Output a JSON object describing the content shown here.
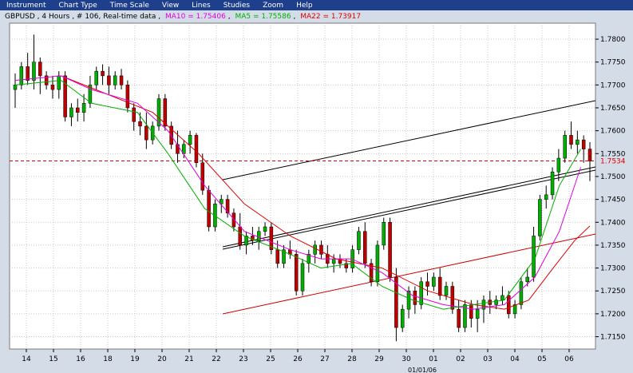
{
  "menu": [
    "Instrument",
    "Chart Type",
    "Time Scale",
    "View",
    "Lines",
    "Studies",
    "Zoom",
    "Help"
  ],
  "header": {
    "symbol": "GBPUSD , 4 Hours , # 106, Real-time data",
    "ma10": "MA10 = 1.75406",
    "ma5": "MA5 = 1.75586",
    "ma22": "MA22 = 1.73917",
    "sep": ","
  },
  "colors": {
    "ma10": "#e000e0",
    "ma5": "#00b000",
    "ma22": "#e00000",
    "bull": "#00b000",
    "bear": "#c00000",
    "menubar": "#1d3f8c"
  },
  "chart_data": {
    "type": "candlestick",
    "y_ticks": [
      "1.7800",
      "1.7750",
      "1.7700",
      "1.7650",
      "1.7600",
      "1.7550",
      "1.7500",
      "1.7450",
      "1.7400",
      "1.7350",
      "1.7300",
      "1.7250",
      "1.7200",
      "1.7150"
    ],
    "y_tick_values": [
      1.78,
      1.775,
      1.77,
      1.765,
      1.76,
      1.755,
      1.75,
      1.745,
      1.74,
      1.735,
      1.73,
      1.725,
      1.72,
      1.715
    ],
    "ylim": [
      1.7123,
      1.7835
    ],
    "x_labels": [
      "14",
      "15",
      "16",
      "18",
      "19",
      "20",
      "21",
      "22",
      "23",
      "25",
      "26",
      "27",
      "28",
      "29",
      "30",
      "01",
      "02",
      "03",
      "04",
      "05",
      "06"
    ],
    "x_sublabel": "01/01/06",
    "current_price": 1.7534,
    "current_price_label": "1.7534",
    "candles": [
      [
        1.769,
        1.7725,
        1.765,
        1.77
      ],
      [
        1.77,
        1.775,
        1.769,
        1.774
      ],
      [
        1.774,
        1.777,
        1.77,
        1.771
      ],
      [
        1.771,
        1.781,
        1.769,
        1.775
      ],
      [
        1.775,
        1.776,
        1.768,
        1.772
      ],
      [
        1.772,
        1.773,
        1.769,
        1.77
      ],
      [
        1.77,
        1.772,
        1.767,
        1.769
      ],
      [
        1.769,
        1.773,
        1.767,
        1.772
      ],
      [
        1.772,
        1.773,
        1.762,
        1.763
      ],
      [
        1.763,
        1.766,
        1.761,
        1.765
      ],
      [
        1.765,
        1.767,
        1.762,
        1.764
      ],
      [
        1.764,
        1.768,
        1.762,
        1.766
      ],
      [
        1.766,
        1.772,
        1.765,
        1.77
      ],
      [
        1.77,
        1.774,
        1.769,
        1.773
      ],
      [
        1.773,
        1.7745,
        1.77,
        1.772
      ],
      [
        1.772,
        1.774,
        1.768,
        1.77
      ],
      [
        1.77,
        1.773,
        1.769,
        1.772
      ],
      [
        1.772,
        1.7735,
        1.769,
        1.77
      ],
      [
        1.77,
        1.771,
        1.764,
        1.765
      ],
      [
        1.765,
        1.766,
        1.76,
        1.762
      ],
      [
        1.762,
        1.764,
        1.759,
        1.761
      ],
      [
        1.761,
        1.764,
        1.756,
        1.758
      ],
      [
        1.758,
        1.762,
        1.757,
        1.761
      ],
      [
        1.761,
        1.768,
        1.76,
        1.767
      ],
      [
        1.767,
        1.768,
        1.76,
        1.761
      ],
      [
        1.761,
        1.762,
        1.756,
        1.757
      ],
      [
        1.757,
        1.76,
        1.753,
        1.755
      ],
      [
        1.755,
        1.758,
        1.754,
        1.757
      ],
      [
        1.757,
        1.76,
        1.755,
        1.759
      ],
      [
        1.759,
        1.7595,
        1.752,
        1.753
      ],
      [
        1.753,
        1.755,
        1.746,
        1.747
      ],
      [
        1.747,
        1.748,
        1.738,
        1.739
      ],
      [
        1.739,
        1.745,
        1.738,
        1.744
      ],
      [
        1.744,
        1.746,
        1.742,
        1.745
      ],
      [
        1.745,
        1.746,
        1.741,
        1.742
      ],
      [
        1.742,
        1.743,
        1.738,
        1.739
      ],
      [
        1.739,
        1.742,
        1.734,
        1.735
      ],
      [
        1.735,
        1.738,
        1.733,
        1.737
      ],
      [
        1.737,
        1.739,
        1.735,
        1.736
      ],
      [
        1.736,
        1.739,
        1.734,
        1.738
      ],
      [
        1.738,
        1.74,
        1.737,
        1.739
      ],
      [
        1.739,
        1.74,
        1.733,
        1.734
      ],
      [
        1.734,
        1.736,
        1.73,
        1.731
      ],
      [
        1.731,
        1.735,
        1.73,
        1.734
      ],
      [
        1.734,
        1.736,
        1.732,
        1.733
      ],
      [
        1.733,
        1.734,
        1.724,
        1.725
      ],
      [
        1.725,
        1.732,
        1.724,
        1.731
      ],
      [
        1.731,
        1.734,
        1.729,
        1.733
      ],
      [
        1.733,
        1.736,
        1.731,
        1.735
      ],
      [
        1.735,
        1.736,
        1.732,
        1.733
      ],
      [
        1.733,
        1.735,
        1.73,
        1.731
      ],
      [
        1.731,
        1.733,
        1.729,
        1.732
      ],
      [
        1.732,
        1.733,
        1.73,
        1.731
      ],
      [
        1.731,
        1.732,
        1.729,
        1.73
      ],
      [
        1.73,
        1.735,
        1.729,
        1.734
      ],
      [
        1.734,
        1.739,
        1.733,
        1.738
      ],
      [
        1.738,
        1.74,
        1.73,
        1.731
      ],
      [
        1.731,
        1.732,
        1.726,
        1.727
      ],
      [
        1.727,
        1.736,
        1.726,
        1.735
      ],
      [
        1.735,
        1.741,
        1.734,
        1.74
      ],
      [
        1.74,
        1.741,
        1.727,
        1.728
      ],
      [
        1.728,
        1.73,
        1.714,
        1.717
      ],
      [
        1.717,
        1.722,
        1.716,
        1.721
      ],
      [
        1.721,
        1.726,
        1.719,
        1.725
      ],
      [
        1.725,
        1.726,
        1.72,
        1.722
      ],
      [
        1.722,
        1.728,
        1.721,
        1.727
      ],
      [
        1.727,
        1.729,
        1.724,
        1.726
      ],
      [
        1.726,
        1.729,
        1.725,
        1.728
      ],
      [
        1.728,
        1.73,
        1.723,
        1.724
      ],
      [
        1.724,
        1.727,
        1.723,
        1.726
      ],
      [
        1.726,
        1.727,
        1.72,
        1.721
      ],
      [
        1.721,
        1.723,
        1.716,
        1.717
      ],
      [
        1.717,
        1.723,
        1.716,
        1.722
      ],
      [
        1.722,
        1.723,
        1.717,
        1.719
      ],
      [
        1.719,
        1.723,
        1.716,
        1.721
      ],
      [
        1.721,
        1.724,
        1.718,
        1.723
      ],
      [
        1.723,
        1.725,
        1.72,
        1.722
      ],
      [
        1.722,
        1.724,
        1.721,
        1.723
      ],
      [
        1.723,
        1.726,
        1.722,
        1.724
      ],
      [
        1.724,
        1.725,
        1.719,
        1.72
      ],
      [
        1.72,
        1.723,
        1.719,
        1.722
      ],
      [
        1.722,
        1.728,
        1.721,
        1.727
      ],
      [
        1.727,
        1.73,
        1.726,
        1.728
      ],
      [
        1.728,
        1.739,
        1.727,
        1.737
      ],
      [
        1.737,
        1.746,
        1.736,
        1.745
      ],
      [
        1.745,
        1.748,
        1.743,
        1.746
      ],
      [
        1.746,
        1.752,
        1.745,
        1.751
      ],
      [
        1.751,
        1.756,
        1.749,
        1.754
      ],
      [
        1.754,
        1.76,
        1.753,
        1.759
      ],
      [
        1.759,
        1.762,
        1.756,
        1.757
      ],
      [
        1.757,
        1.76,
        1.755,
        1.758
      ],
      [
        1.758,
        1.759,
        1.753,
        1.756
      ],
      [
        1.756,
        1.7575,
        1.749,
        1.7534
      ]
    ],
    "ma5": [
      [
        0,
        1.77
      ],
      [
        15,
        1.771
      ],
      [
        25,
        1.766
      ],
      [
        40,
        1.764
      ],
      [
        50,
        1.755
      ],
      [
        62,
        1.743
      ],
      [
        75,
        1.737
      ],
      [
        90,
        1.733
      ],
      [
        100,
        1.73
      ],
      [
        110,
        1.731
      ],
      [
        120,
        1.726
      ],
      [
        130,
        1.723
      ],
      [
        140,
        1.721
      ],
      [
        150,
        1.722
      ],
      [
        160,
        1.723
      ],
      [
        170,
        1.732
      ],
      [
        178,
        1.748
      ],
      [
        185,
        1.756
      ]
    ],
    "ma10": [
      [
        0,
        1.771
      ],
      [
        15,
        1.772
      ],
      [
        25,
        1.769
      ],
      [
        40,
        1.766
      ],
      [
        50,
        1.76
      ],
      [
        62,
        1.748
      ],
      [
        75,
        1.738
      ],
      [
        90,
        1.734
      ],
      [
        100,
        1.732
      ],
      [
        110,
        1.732
      ],
      [
        120,
        1.729
      ],
      [
        130,
        1.724
      ],
      [
        140,
        1.722
      ],
      [
        150,
        1.721
      ],
      [
        160,
        1.722
      ],
      [
        170,
        1.728
      ],
      [
        178,
        1.738
      ],
      [
        185,
        1.752
      ]
    ],
    "ma22": [
      [
        15,
        1.772
      ],
      [
        30,
        1.768
      ],
      [
        45,
        1.764
      ],
      [
        60,
        1.755
      ],
      [
        75,
        1.744
      ],
      [
        90,
        1.737
      ],
      [
        105,
        1.732
      ],
      [
        120,
        1.73
      ],
      [
        135,
        1.725
      ],
      [
        150,
        1.722
      ],
      [
        160,
        1.721
      ],
      [
        168,
        1.723
      ],
      [
        176,
        1.73
      ],
      [
        183,
        1.736
      ],
      [
        188,
        1.7392
      ]
    ]
  }
}
